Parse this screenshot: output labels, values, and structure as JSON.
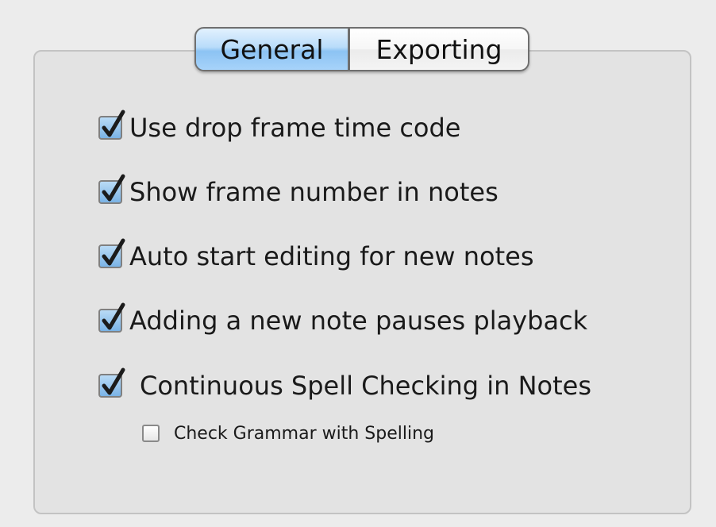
{
  "tabs": {
    "general": "General",
    "exporting": "Exporting",
    "selected": "General"
  },
  "options": {
    "use_drop_frame": {
      "label": "Use drop frame time code",
      "checked": true
    },
    "show_frame_number": {
      "label": "Show frame number in notes",
      "checked": true
    },
    "auto_start_editing": {
      "label": "Auto start editing for new notes",
      "checked": true
    },
    "pause_playback": {
      "label": "Adding a new note pauses playback",
      "checked": true
    },
    "continuous_spell": {
      "label": "Continuous Spell Checking in Notes",
      "checked": true
    },
    "check_grammar": {
      "label": "Check Grammar with Spelling",
      "checked": false
    }
  },
  "icons": {
    "checkmark": "checkmark-icon"
  },
  "colors": {
    "selected_tab": "#a9d2f7",
    "checkbox_fill": "#8fc0ec",
    "checkmark": "#1b1b1b",
    "window_bg": "#ececec",
    "panel_bg": "#e3e3e3"
  }
}
